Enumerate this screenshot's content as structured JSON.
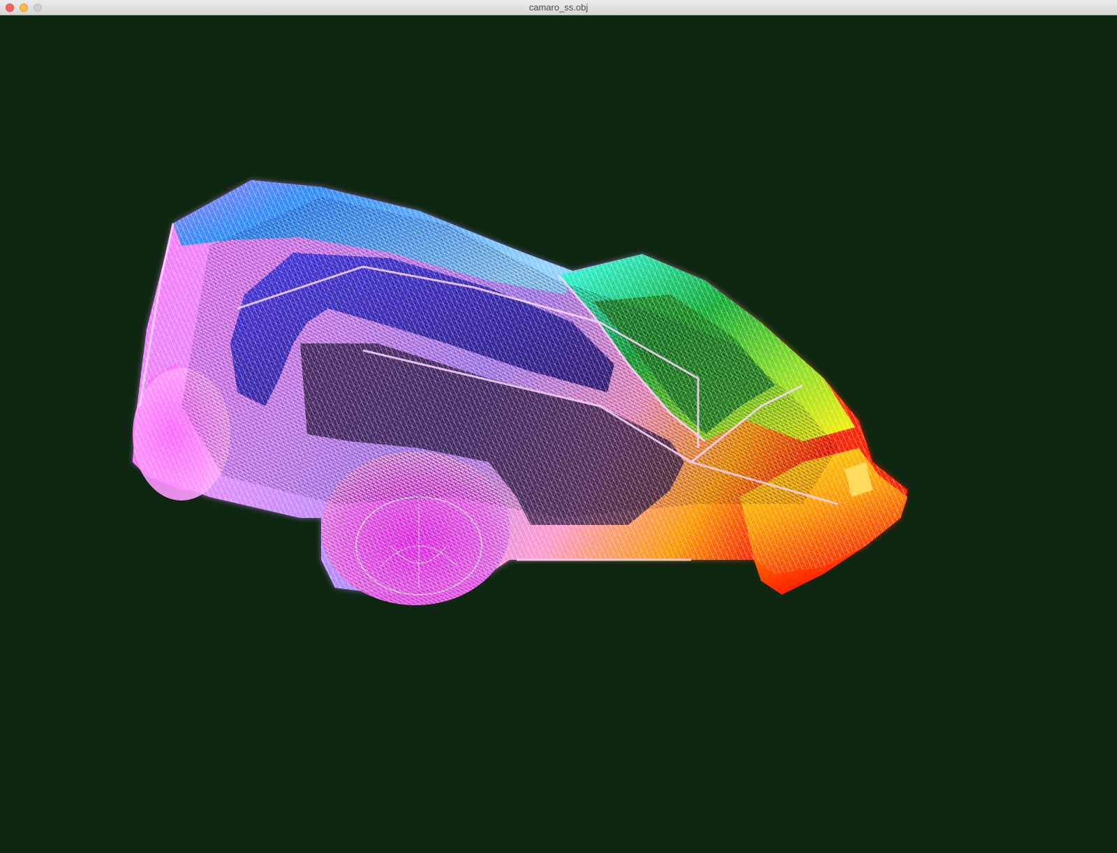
{
  "window": {
    "title": "camaro_ss.obj"
  },
  "viewport": {
    "background": "#0e2711",
    "model_icon": "wireframe-car-model"
  },
  "colors": {
    "rear": "#ff66ff",
    "roof": "#2a8cff",
    "hood": "#00cc33",
    "windshield_edge": "#33ffee",
    "front": "#ffcc00",
    "bumper": "#ff2200"
  }
}
